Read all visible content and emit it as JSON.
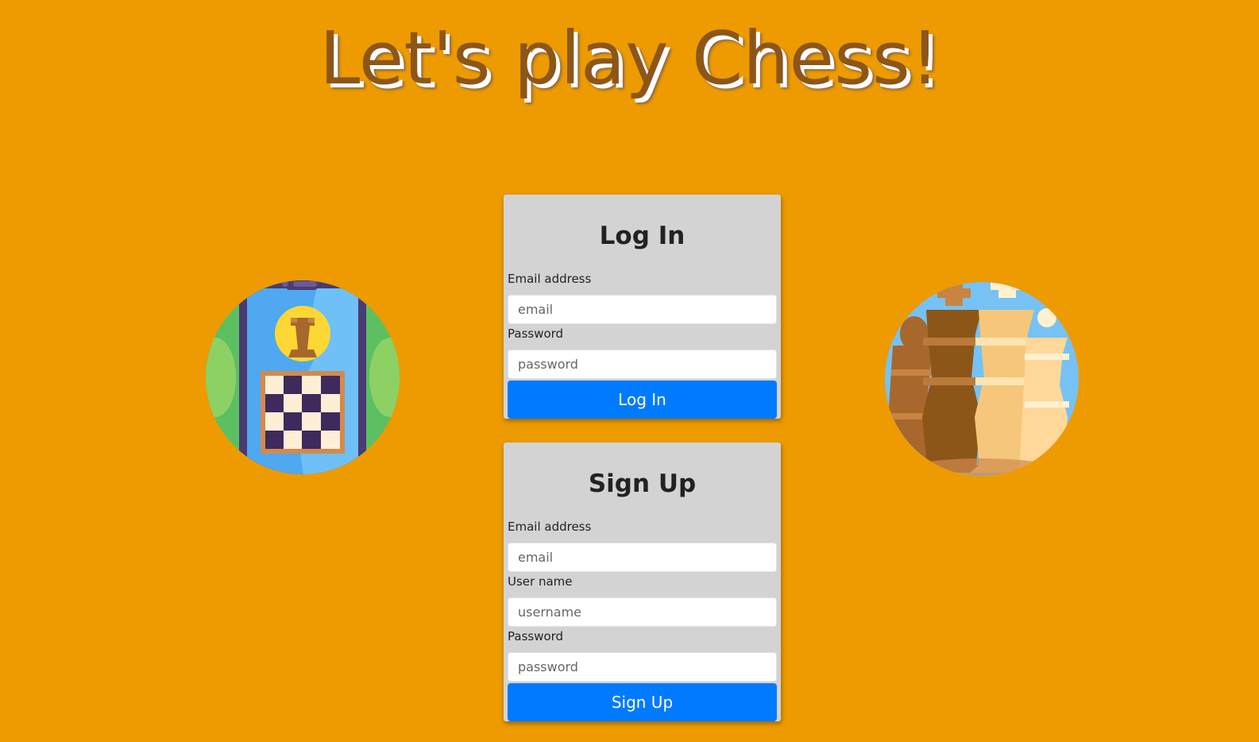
{
  "page": {
    "title": "Let's play Chess!",
    "background_color": "#ED9B00",
    "title_color": "#8D5619"
  },
  "login": {
    "heading": "Log In",
    "email_label": "Email address",
    "email_placeholder": "email",
    "email_value": "",
    "password_label": "Password",
    "password_placeholder": "password",
    "password_value": "",
    "button_label": "Log In"
  },
  "signup": {
    "heading": "Sign Up",
    "email_label": "Email address",
    "email_placeholder": "email",
    "email_value": "",
    "username_label": "User name",
    "username_placeholder": "username",
    "username_value": "",
    "password_label": "Password",
    "password_placeholder": "password",
    "password_value": "",
    "button_label": "Sign Up"
  },
  "illustrations": {
    "left_icon": "mobile-chess-icon",
    "right_icon": "chess-pieces-icon"
  },
  "colors": {
    "button": "#007BFF",
    "card": "#D3D3D3"
  }
}
